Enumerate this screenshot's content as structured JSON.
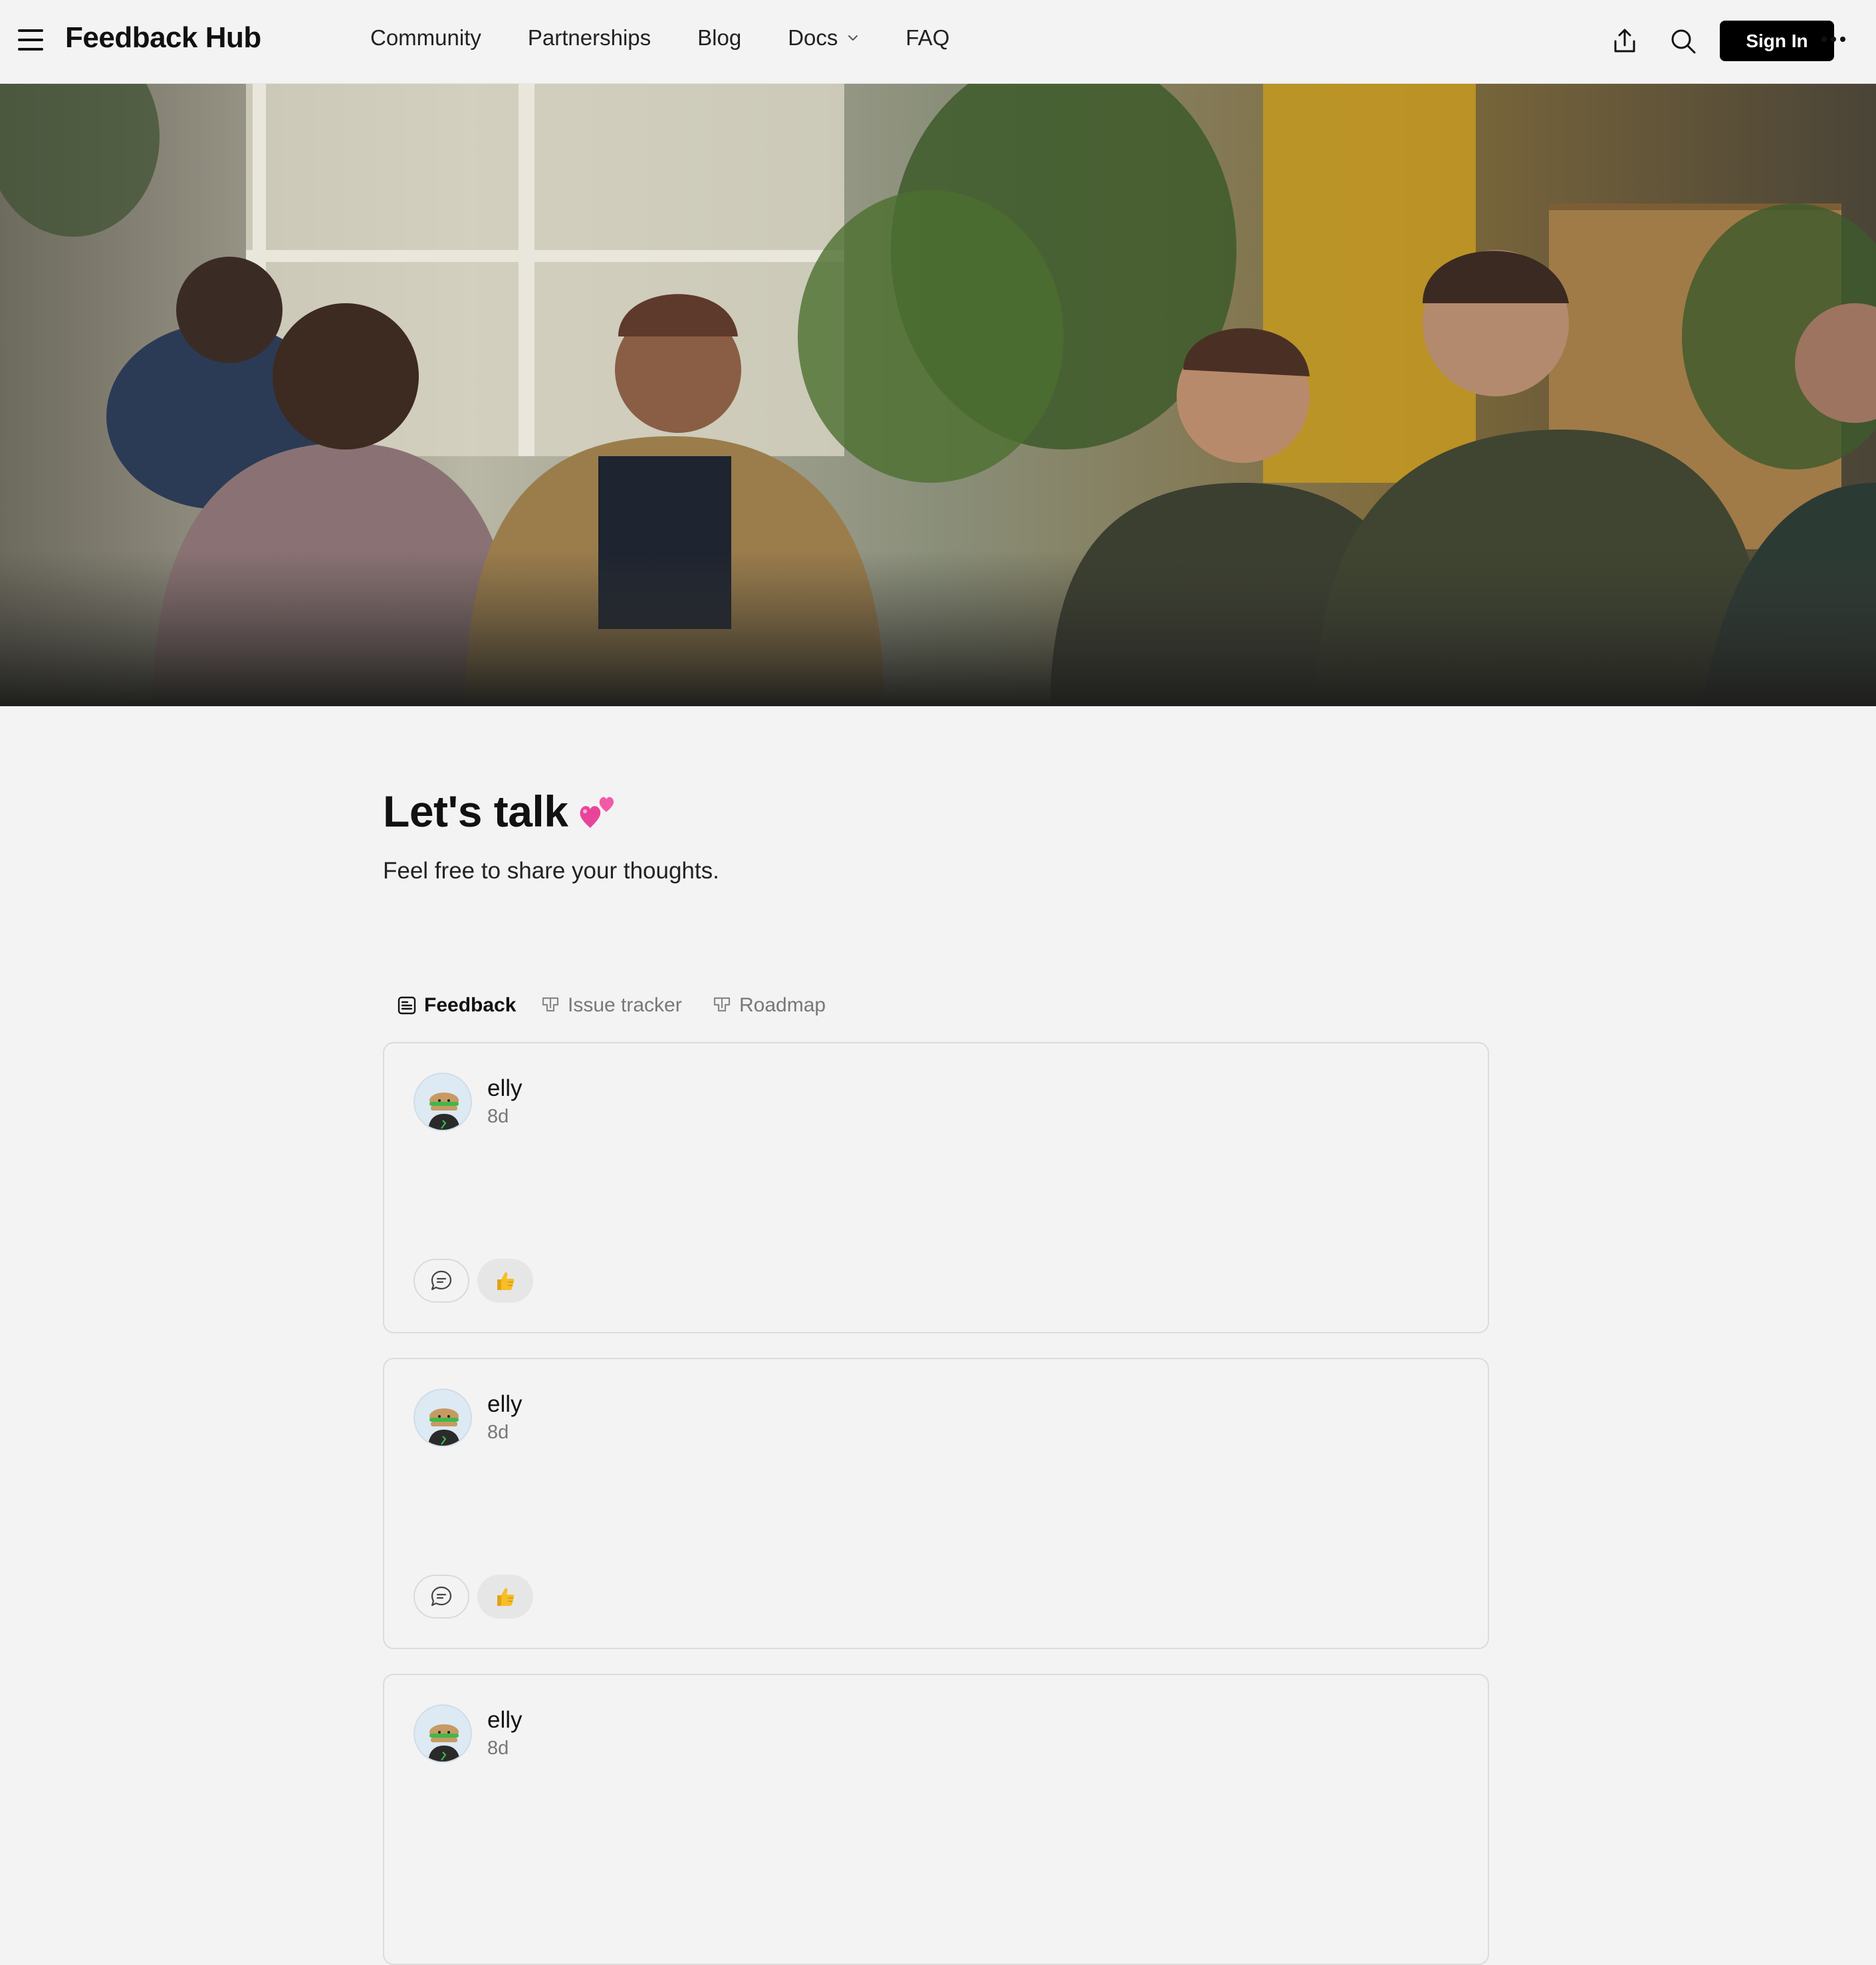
{
  "nav": {
    "brand": "Feedback Hub",
    "links": [
      "Community",
      "Partnerships",
      "Blog",
      "Docs",
      "FAQ"
    ],
    "signin_label": "Sign In"
  },
  "page": {
    "title": "Let's talk",
    "title_emoji": "heart-emoji",
    "subtitle": "Feel free to share your thoughts."
  },
  "tabs": [
    {
      "label": "Feedback",
      "icon": "feedback-icon",
      "active": true
    },
    {
      "label": "Issue tracker",
      "icon": "issue-tracker-icon",
      "active": false
    },
    {
      "label": "Roadmap",
      "icon": "roadmap-icon",
      "active": false
    }
  ],
  "posts": [
    {
      "author": "elly",
      "time": "8d"
    },
    {
      "author": "elly",
      "time": "8d"
    },
    {
      "author": "elly",
      "time": "8d"
    }
  ]
}
